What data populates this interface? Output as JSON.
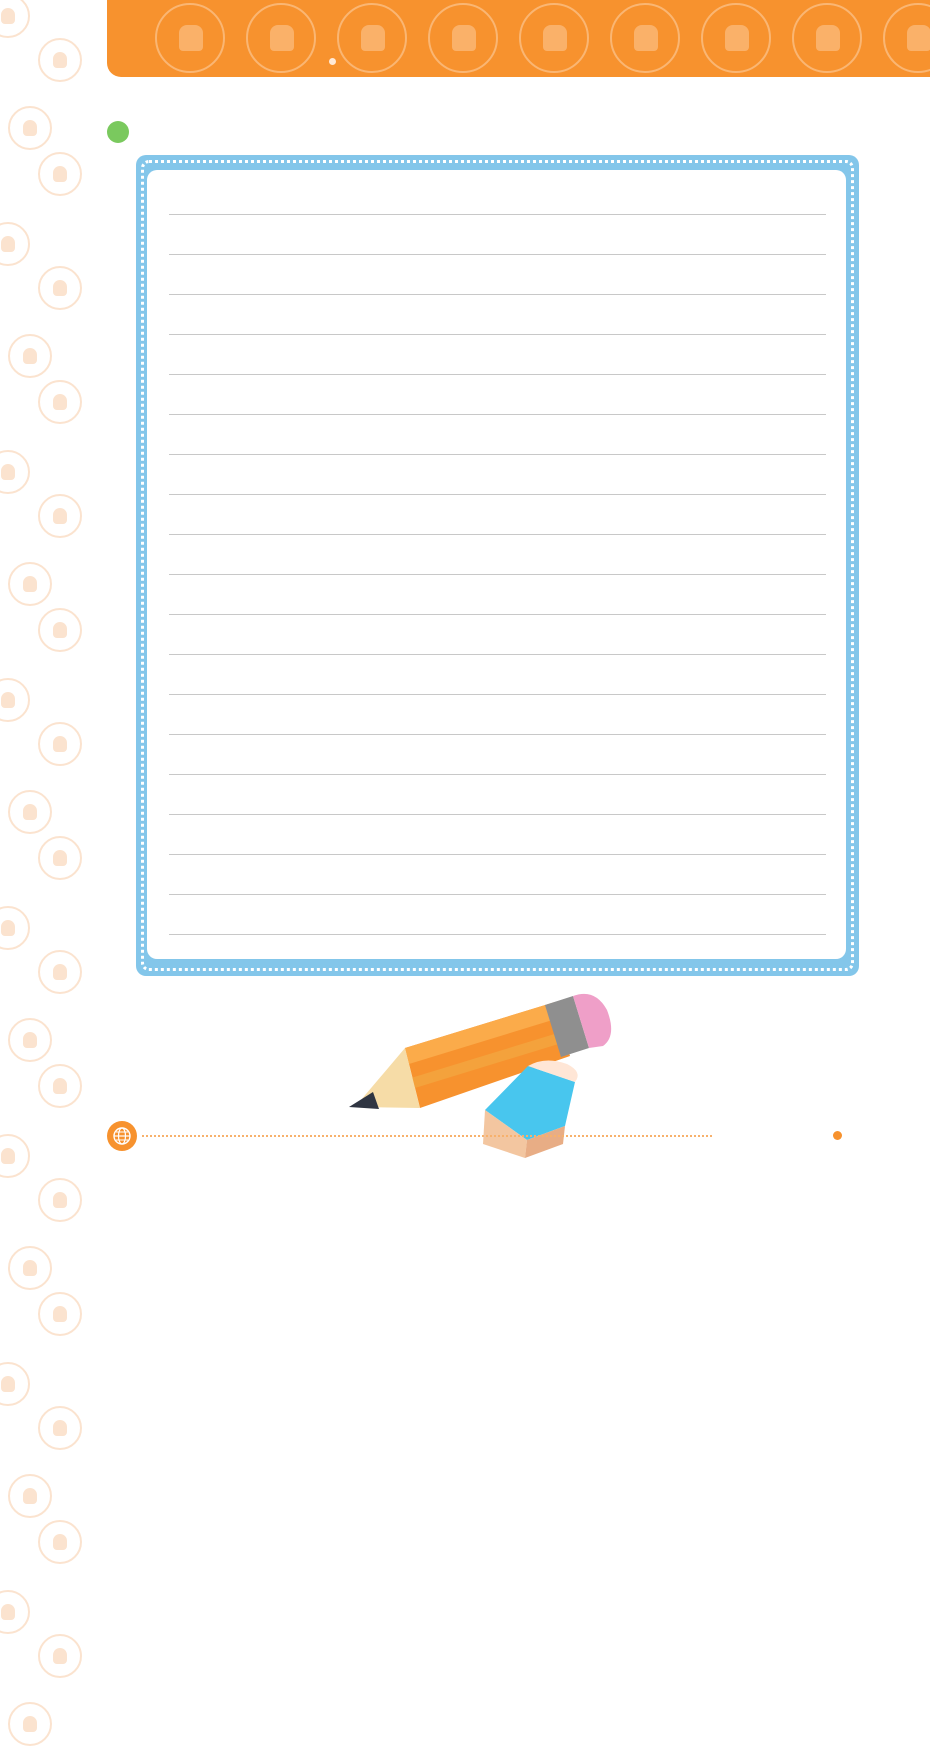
{
  "decor": {
    "side_icons": [
      "dome-icon",
      "person-icon",
      "drop-icon",
      "globe-icon",
      "tree-icon",
      "drop-icon",
      "farmer-icon",
      "globe-icon",
      "building-icon",
      "eagle-icon",
      "earth-icon",
      "eagle-icon",
      "person-icon",
      "globe-icon",
      "eagle-icon",
      "tree-icon",
      "farmer-icon",
      "globe-icon",
      "eagle-icon",
      "person-icon",
      "earth-icon",
      "person-icon",
      "drop-icon",
      "globe-icon",
      "tree-icon",
      "drop-icon",
      "farmer-icon",
      "globe-icon",
      "building-icon",
      "eagle-icon",
      "earth-icon"
    ],
    "banner_icons": [
      "helmet-icon",
      "columns-icon",
      "eagle-icon",
      "worker-icon",
      "earth-icon",
      "eagle-icon",
      "compass-icon",
      "tree-icon",
      "drop-icon"
    ],
    "colors": {
      "banner": "#f7922e",
      "frame": "#83c6ea",
      "bullet": "#7ac95e",
      "side_icon": "#fbe3cf"
    }
  },
  "writing_area": {
    "line_count": 19
  },
  "footer": {
    "icon": "globe-icon",
    "illustration": "pencil-eraser-illustration"
  }
}
